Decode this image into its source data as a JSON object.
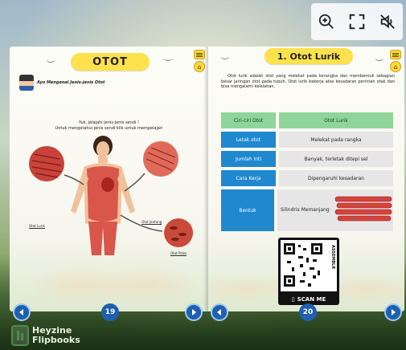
{
  "toolbar": {
    "zoom_icon": "zoom-in-icon",
    "fullscreen_icon": "fullscreen-icon",
    "mute_icon": "speaker-muted-icon"
  },
  "left_page": {
    "title": "OTOT",
    "subtitle": "Ayo Mengenal Jenis-jenis Otot",
    "intro_line1": "Yuk, jelajahi jenis-jenis sendi !",
    "intro_line2": "Untuk mengetahui jenis sendi klik untuk mempelajari",
    "labels": {
      "lurik": "Otot Lurik",
      "jantung": "Otot Jantung",
      "polos": "Otot Polos"
    },
    "page_number": "19"
  },
  "right_page": {
    "title": "1.  Otot Lurik",
    "paragraph": "Otot lurik adalah otot yang melekat pada kerangka dan membentuk sebagian besar jaringan otot pada tubuh. Otot lurik bekerja atas kesadaran perintah otak dan bisa mengalami kelelahan.",
    "table": {
      "header": [
        "Ciri-ciri Otot",
        "Otot Lurik"
      ],
      "rows": [
        [
          "Letak otot",
          "Melekat pada rangka"
        ],
        [
          "Jumlah Inti",
          "Banyak, terletak ditepi sel"
        ],
        [
          "Cara Kerja",
          "Dipengaruhi kesadaran"
        ]
      ],
      "bentuk_label": "Bentuk",
      "bentuk_value": "Silindris Memanjang"
    },
    "qr_side_text": "ASSEMBLR",
    "qr_scan_label": "SCAN ME",
    "page_number": "20"
  },
  "branding": {
    "line1": "Heyzine",
    "line2": "Flipbooks"
  },
  "colors": {
    "title_yellow": "#ffe14d",
    "table_blue": "#1f88cf",
    "table_green": "#8fd59a",
    "nav_blue": "#1f5fb0"
  }
}
